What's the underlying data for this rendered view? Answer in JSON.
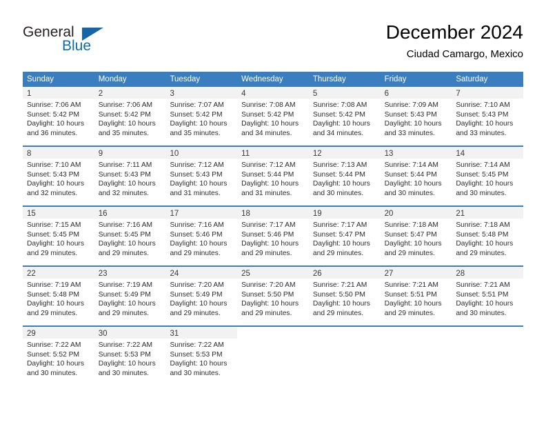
{
  "brand": {
    "name_part1": "General",
    "name_part2": "Blue",
    "flag_icon": "triangle-flag-icon",
    "accent_color": "#1565a8",
    "text_color": "#231f20"
  },
  "header": {
    "title": "December 2024",
    "subtitle": "Ciudad Camargo, Mexico"
  },
  "theme": {
    "header_blue": "#3b7ebf",
    "daynum_band": "#f2f2f2",
    "text": "#2b2b2b"
  },
  "weekdays": [
    "Sunday",
    "Monday",
    "Tuesday",
    "Wednesday",
    "Thursday",
    "Friday",
    "Saturday"
  ],
  "weeks": [
    [
      {
        "day": "1",
        "sunrise": "Sunrise: 7:06 AM",
        "sunset": "Sunset: 5:42 PM",
        "daylight1": "Daylight: 10 hours",
        "daylight2": "and 36 minutes."
      },
      {
        "day": "2",
        "sunrise": "Sunrise: 7:06 AM",
        "sunset": "Sunset: 5:42 PM",
        "daylight1": "Daylight: 10 hours",
        "daylight2": "and 35 minutes."
      },
      {
        "day": "3",
        "sunrise": "Sunrise: 7:07 AM",
        "sunset": "Sunset: 5:42 PM",
        "daylight1": "Daylight: 10 hours",
        "daylight2": "and 35 minutes."
      },
      {
        "day": "4",
        "sunrise": "Sunrise: 7:08 AM",
        "sunset": "Sunset: 5:42 PM",
        "daylight1": "Daylight: 10 hours",
        "daylight2": "and 34 minutes."
      },
      {
        "day": "5",
        "sunrise": "Sunrise: 7:08 AM",
        "sunset": "Sunset: 5:42 PM",
        "daylight1": "Daylight: 10 hours",
        "daylight2": "and 34 minutes."
      },
      {
        "day": "6",
        "sunrise": "Sunrise: 7:09 AM",
        "sunset": "Sunset: 5:43 PM",
        "daylight1": "Daylight: 10 hours",
        "daylight2": "and 33 minutes."
      },
      {
        "day": "7",
        "sunrise": "Sunrise: 7:10 AM",
        "sunset": "Sunset: 5:43 PM",
        "daylight1": "Daylight: 10 hours",
        "daylight2": "and 33 minutes."
      }
    ],
    [
      {
        "day": "8",
        "sunrise": "Sunrise: 7:10 AM",
        "sunset": "Sunset: 5:43 PM",
        "daylight1": "Daylight: 10 hours",
        "daylight2": "and 32 minutes."
      },
      {
        "day": "9",
        "sunrise": "Sunrise: 7:11 AM",
        "sunset": "Sunset: 5:43 PM",
        "daylight1": "Daylight: 10 hours",
        "daylight2": "and 32 minutes."
      },
      {
        "day": "10",
        "sunrise": "Sunrise: 7:12 AM",
        "sunset": "Sunset: 5:43 PM",
        "daylight1": "Daylight: 10 hours",
        "daylight2": "and 31 minutes."
      },
      {
        "day": "11",
        "sunrise": "Sunrise: 7:12 AM",
        "sunset": "Sunset: 5:44 PM",
        "daylight1": "Daylight: 10 hours",
        "daylight2": "and 31 minutes."
      },
      {
        "day": "12",
        "sunrise": "Sunrise: 7:13 AM",
        "sunset": "Sunset: 5:44 PM",
        "daylight1": "Daylight: 10 hours",
        "daylight2": "and 30 minutes."
      },
      {
        "day": "13",
        "sunrise": "Sunrise: 7:14 AM",
        "sunset": "Sunset: 5:44 PM",
        "daylight1": "Daylight: 10 hours",
        "daylight2": "and 30 minutes."
      },
      {
        "day": "14",
        "sunrise": "Sunrise: 7:14 AM",
        "sunset": "Sunset: 5:45 PM",
        "daylight1": "Daylight: 10 hours",
        "daylight2": "and 30 minutes."
      }
    ],
    [
      {
        "day": "15",
        "sunrise": "Sunrise: 7:15 AM",
        "sunset": "Sunset: 5:45 PM",
        "daylight1": "Daylight: 10 hours",
        "daylight2": "and 29 minutes."
      },
      {
        "day": "16",
        "sunrise": "Sunrise: 7:16 AM",
        "sunset": "Sunset: 5:45 PM",
        "daylight1": "Daylight: 10 hours",
        "daylight2": "and 29 minutes."
      },
      {
        "day": "17",
        "sunrise": "Sunrise: 7:16 AM",
        "sunset": "Sunset: 5:46 PM",
        "daylight1": "Daylight: 10 hours",
        "daylight2": "and 29 minutes."
      },
      {
        "day": "18",
        "sunrise": "Sunrise: 7:17 AM",
        "sunset": "Sunset: 5:46 PM",
        "daylight1": "Daylight: 10 hours",
        "daylight2": "and 29 minutes."
      },
      {
        "day": "19",
        "sunrise": "Sunrise: 7:17 AM",
        "sunset": "Sunset: 5:47 PM",
        "daylight1": "Daylight: 10 hours",
        "daylight2": "and 29 minutes."
      },
      {
        "day": "20",
        "sunrise": "Sunrise: 7:18 AM",
        "sunset": "Sunset: 5:47 PM",
        "daylight1": "Daylight: 10 hours",
        "daylight2": "and 29 minutes."
      },
      {
        "day": "21",
        "sunrise": "Sunrise: 7:18 AM",
        "sunset": "Sunset: 5:48 PM",
        "daylight1": "Daylight: 10 hours",
        "daylight2": "and 29 minutes."
      }
    ],
    [
      {
        "day": "22",
        "sunrise": "Sunrise: 7:19 AM",
        "sunset": "Sunset: 5:48 PM",
        "daylight1": "Daylight: 10 hours",
        "daylight2": "and 29 minutes."
      },
      {
        "day": "23",
        "sunrise": "Sunrise: 7:19 AM",
        "sunset": "Sunset: 5:49 PM",
        "daylight1": "Daylight: 10 hours",
        "daylight2": "and 29 minutes."
      },
      {
        "day": "24",
        "sunrise": "Sunrise: 7:20 AM",
        "sunset": "Sunset: 5:49 PM",
        "daylight1": "Daylight: 10 hours",
        "daylight2": "and 29 minutes."
      },
      {
        "day": "25",
        "sunrise": "Sunrise: 7:20 AM",
        "sunset": "Sunset: 5:50 PM",
        "daylight1": "Daylight: 10 hours",
        "daylight2": "and 29 minutes."
      },
      {
        "day": "26",
        "sunrise": "Sunrise: 7:21 AM",
        "sunset": "Sunset: 5:50 PM",
        "daylight1": "Daylight: 10 hours",
        "daylight2": "and 29 minutes."
      },
      {
        "day": "27",
        "sunrise": "Sunrise: 7:21 AM",
        "sunset": "Sunset: 5:51 PM",
        "daylight1": "Daylight: 10 hours",
        "daylight2": "and 29 minutes."
      },
      {
        "day": "28",
        "sunrise": "Sunrise: 7:21 AM",
        "sunset": "Sunset: 5:51 PM",
        "daylight1": "Daylight: 10 hours",
        "daylight2": "and 30 minutes."
      }
    ],
    [
      {
        "day": "29",
        "sunrise": "Sunrise: 7:22 AM",
        "sunset": "Sunset: 5:52 PM",
        "daylight1": "Daylight: 10 hours",
        "daylight2": "and 30 minutes."
      },
      {
        "day": "30",
        "sunrise": "Sunrise: 7:22 AM",
        "sunset": "Sunset: 5:53 PM",
        "daylight1": "Daylight: 10 hours",
        "daylight2": "and 30 minutes."
      },
      {
        "day": "31",
        "sunrise": "Sunrise: 7:22 AM",
        "sunset": "Sunset: 5:53 PM",
        "daylight1": "Daylight: 10 hours",
        "daylight2": "and 30 minutes."
      },
      {
        "day": "",
        "sunrise": "",
        "sunset": "",
        "daylight1": "",
        "daylight2": ""
      },
      {
        "day": "",
        "sunrise": "",
        "sunset": "",
        "daylight1": "",
        "daylight2": ""
      },
      {
        "day": "",
        "sunrise": "",
        "sunset": "",
        "daylight1": "",
        "daylight2": ""
      },
      {
        "day": "",
        "sunrise": "",
        "sunset": "",
        "daylight1": "",
        "daylight2": ""
      }
    ]
  ]
}
